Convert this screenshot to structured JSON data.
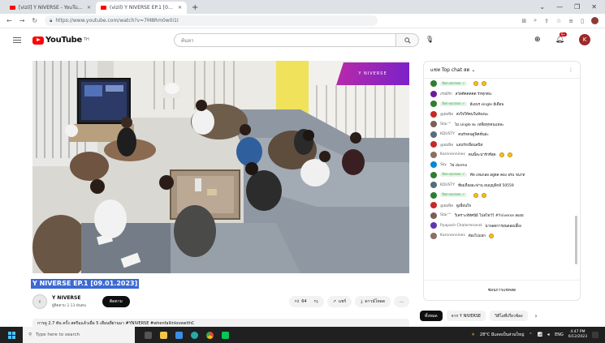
{
  "browser": {
    "tabs": [
      {
        "title": "[vizil] Y NIVERSE - YouTube",
        "active": false
      },
      {
        "title": "(vizil) Y NIVERSE EP.1 [09.0",
        "active": true
      }
    ],
    "new_tab": "+",
    "url": "https://www.youtube.com/watch?v=7M8Rm0w0i1I",
    "window_controls": [
      "⌄",
      "—",
      "❐",
      "✕"
    ]
  },
  "youtube": {
    "logo_text": "YouTube",
    "logo_sup": "TH",
    "search_placeholder": "ค้นหา",
    "notification_count": "9+",
    "account_initial": "K"
  },
  "video": {
    "overlay_text": "Y NIVERSE",
    "title": "Y NIVERSE EP.1 [09.01.2023]",
    "channel_name": "Y NIVERSE",
    "subscribers": "ผู้ติดตาม 2.13 พันคน",
    "subscribe_label": "ติดตาม",
    "like_count": "64",
    "share_label": "แชร์",
    "download_label": "ดาวน์โหลด",
    "more_label": "…",
    "description": "การดู 2.7 พัน ครั้ง  สตรีมแล้วเมื่อ 5 เดือนที่ผ่านมา  #YNIVERSE  #whenfallinlovewithC"
  },
  "chat": {
    "header": "แชท Top chat สด",
    "footer": "ซ่อนการแชทสด",
    "messages": [
      {
        "author": "Yan·across ✓",
        "text": "",
        "emojis": 2,
        "member": true,
        "color": "#2e7d32"
      },
      {
        "author": "ภรณ์รัก",
        "text": "สวัสดีคคคคต รักทุกคน",
        "emojis": 0,
        "member": false,
        "color": "#6a1b9a"
      },
      {
        "author": "Yan·across ✓",
        "text": "อีเอนร single อีเดือน",
        "emojis": 0,
        "member": true,
        "color": "#2e7d32"
      },
      {
        "author": "@ยมพิล",
        "text": "ส่งใจให้คนในห้องนะ",
        "emojis": 0,
        "member": false,
        "color": "#c62828"
      },
      {
        "author": "Star™",
        "text": "ไม่ single ละ เหลือทุกคนแหละ",
        "emojis": 0,
        "member": false,
        "color": "#7b5e57"
      },
      {
        "author": "KDUSTY",
        "text": "คนรักคนดูฟิคชั่นล่ะ",
        "emojis": 0,
        "member": false,
        "color": "#546e7a"
      },
      {
        "author": "@ยมพิล",
        "text": "แอบรักเพื่อนสนิท",
        "emojis": 0,
        "member": false,
        "color": "#c62828"
      },
      {
        "author": "Karnnennines",
        "text": "คนนี้ละน่ารักที่สุด",
        "emojis": 2,
        "member": false,
        "color": "#8d6e63"
      },
      {
        "author": "Sky",
        "text": "ไฟ dormo",
        "emojis": 0,
        "member": false,
        "color": "#0288d1"
      },
      {
        "author": "Yan·across ✓",
        "text": "ทีท เทนกลย อยู่ตค คอง อรบ ขนาท",
        "emojis": 0,
        "member": true,
        "color": "#2e7d32"
      },
      {
        "author": "KDUSTY",
        "text": "ที่ผมถือออะฟาน อนบุญพิกส์ 50559",
        "emojis": 0,
        "member": false,
        "color": "#546e7a"
      },
      {
        "author": "Yan·across ✓",
        "text": "",
        "emojis": 2,
        "member": true,
        "color": "#2e7d32"
      },
      {
        "author": "@ยมพิล",
        "text": "ดูเพื่อนใจ",
        "emojis": 0,
        "member": false,
        "color": "#c62828"
      },
      {
        "author": "Star™",
        "text": "วิเคราะห์ทัศนีย์ โปสไทว์ว์ #Yniverse ลองย",
        "emojis": 0,
        "member": false,
        "color": "#7b5e57"
      },
      {
        "author": "Pyapach Chalermnarat",
        "text": "น่าจอดการฝนดอยเอี๊ยง",
        "emojis": 0,
        "member": false,
        "color": "#5e35b1"
      },
      {
        "author": "Karnnennines",
        "text": "ต้องไปแยก",
        "emojis": 1,
        "member": false,
        "color": "#8d6e63"
      }
    ]
  },
  "chips": {
    "items": [
      "ทั้งหมด",
      "จาก Y NIVERSE",
      "วิดีโอที่เกี่ยวข้อง"
    ],
    "active_index": 0,
    "next": "›"
  },
  "taskbar": {
    "search_placeholder": "Type here to search",
    "weather": "28°C มีแดดเป็นส่วนใหญ่",
    "language": "ENG",
    "time": "4:47 PM",
    "date": "6/12/2023"
  },
  "colors": {
    "youtube_red": "#ff0000",
    "overlay_gradient_start": "#b92aa8",
    "overlay_gradient_end": "#7a21c9",
    "title_highlight": "#3b6ad2"
  }
}
